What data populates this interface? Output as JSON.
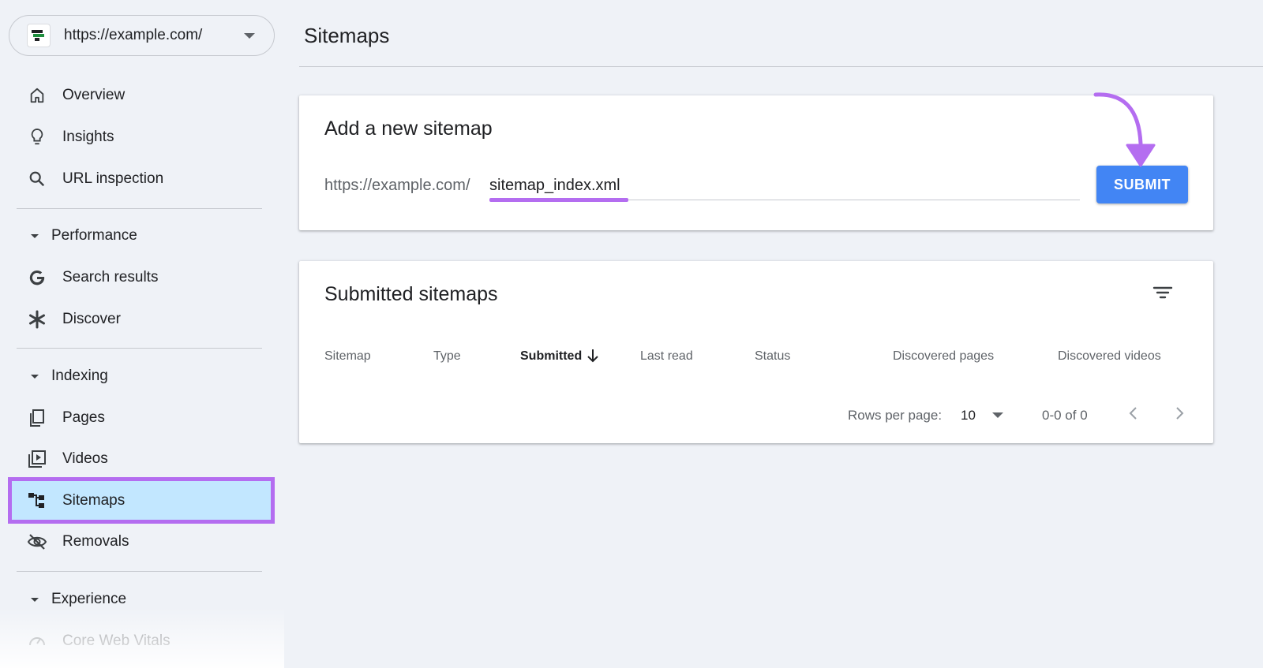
{
  "property": {
    "url": "https://example.com/"
  },
  "sidebar": {
    "items": [
      {
        "label": "Overview",
        "icon": "home-icon"
      },
      {
        "label": "Insights",
        "icon": "lightbulb-icon"
      },
      {
        "label": "URL inspection",
        "icon": "search-icon"
      }
    ],
    "sections": [
      {
        "label": "Performance",
        "items": [
          {
            "label": "Search results",
            "icon": "google-g-icon"
          },
          {
            "label": "Discover",
            "icon": "asterisk-icon"
          }
        ]
      },
      {
        "label": "Indexing",
        "items": [
          {
            "label": "Pages",
            "icon": "pages-icon"
          },
          {
            "label": "Videos",
            "icon": "video-library-icon"
          },
          {
            "label": "Sitemaps",
            "icon": "sitemap-icon",
            "active": true
          },
          {
            "label": "Removals",
            "icon": "eye-off-icon"
          }
        ]
      },
      {
        "label": "Experience",
        "items": [
          {
            "label": "Core Web Vitals",
            "icon": "speed-gauge-icon"
          }
        ]
      }
    ]
  },
  "page": {
    "title": "Sitemaps"
  },
  "add_sitemap": {
    "title": "Add a new sitemap",
    "url_prefix": "https://example.com/",
    "input_value": "sitemap_index.xml",
    "submit_label": "SUBMIT"
  },
  "submitted": {
    "title": "Submitted sitemaps",
    "columns": [
      "Sitemap",
      "Type",
      "Submitted",
      "Last read",
      "Status",
      "Discovered pages",
      "Discovered videos"
    ],
    "sort_column": "Submitted",
    "rows": [],
    "pagination": {
      "rows_label": "Rows per page:",
      "rows_per_page": "10",
      "range": "0-0 of 0"
    }
  },
  "colors": {
    "accent": "#4285f4",
    "highlight": "#b46df0",
    "active_bg": "#c2e7ff",
    "background": "#eff2f7"
  }
}
